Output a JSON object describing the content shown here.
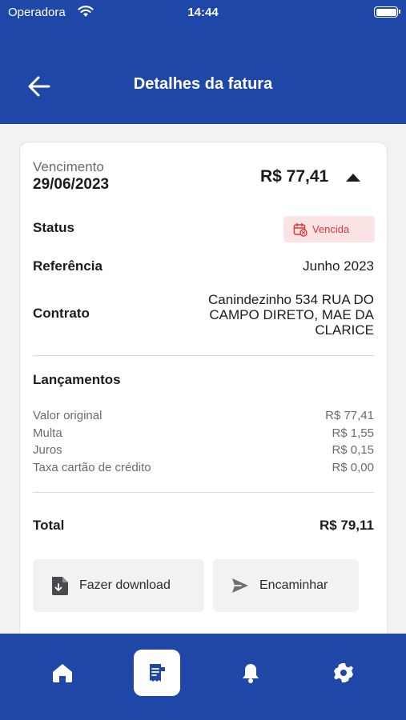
{
  "status_bar": {
    "carrier": "Operadora",
    "time": "14:44"
  },
  "header": {
    "title": "Detalhes da fatura",
    "back_icon": "arrow-left-icon"
  },
  "invoice": {
    "due_label": "Vencimento",
    "due_date": "29/06/2023",
    "amount": "R$ 77,41",
    "status_label": "Status",
    "status_badge": "Vencida",
    "reference_label": "Referência",
    "reference_value": "Junho 2023",
    "contract_label": "Contrato",
    "contract_value": "Canindezinho 534 RUA DO CAMPO DIRETO, MAE DA CLARICE",
    "entries_title": "Lançamentos",
    "entries": [
      {
        "label": "Valor original",
        "value": "R$ 77,41"
      },
      {
        "label": "Multa",
        "value": "R$ 1,55"
      },
      {
        "label": "Juros",
        "value": "R$ 0,15"
      },
      {
        "label": "Taxa cartão de crédito",
        "value": "R$ 0,00"
      }
    ],
    "total_label": "Total",
    "total_value": "R$ 79,11"
  },
  "actions": {
    "download_label": "Fazer download",
    "forward_label": "Encaminhar"
  },
  "tabbar": {
    "items": [
      "home-icon",
      "receipt-icon",
      "bell-icon",
      "gear-icon"
    ],
    "active": "receipt-icon"
  },
  "colors": {
    "primary": "#1f47a8",
    "badge_bg": "#fde4e4",
    "badge_text": "#d93838"
  }
}
